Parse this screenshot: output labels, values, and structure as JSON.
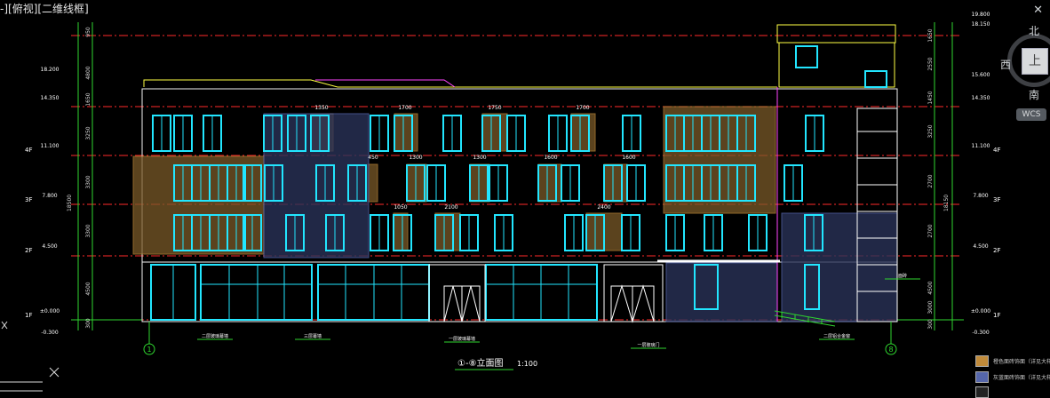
{
  "viewport": {
    "label": "-][俯视][二维线框]"
  },
  "viewcube": {
    "north": "北",
    "west": "西",
    "south": "南",
    "face": "上",
    "wcs": "WCS"
  },
  "drawing": {
    "title": "①-⑧立面图",
    "scale": "1:100",
    "axis_left": "1",
    "axis_right": "8",
    "levels_left": [
      {
        "name": "",
        "value": "18.200"
      },
      {
        "name": "",
        "value": "14.350"
      },
      {
        "name": "4F",
        "value": "11.100"
      },
      {
        "name": "3F",
        "value": "7.800"
      },
      {
        "name": "2F",
        "value": "4.500"
      },
      {
        "name": "1F",
        "value": "±0.000"
      },
      {
        "name": "",
        "value": "-0.300"
      }
    ],
    "levels_right": [
      {
        "name": "",
        "value": "19.800"
      },
      {
        "name": "",
        "value": "18.150"
      },
      {
        "name": "",
        "value": "15.600"
      },
      {
        "name": "",
        "value": "14.350"
      },
      {
        "name": "4F",
        "value": "11.100"
      },
      {
        "name": "3F",
        "value": "7.800"
      },
      {
        "name": "2F",
        "value": "4.500"
      },
      {
        "name": "1F",
        "value": "±0.000"
      },
      {
        "name": "",
        "value": "-0.300"
      }
    ],
    "dims_left": [
      "950",
      "4800",
      "1650",
      "3250",
      "3300",
      "3300",
      "4500",
      "300"
    ],
    "dims_right": [
      "1650",
      "2550",
      "1450",
      "3250",
      "2700",
      "2700",
      "4500",
      "3000",
      "300"
    ],
    "overall_left": "18500",
    "overall_right": "18150",
    "window_dims": [
      "1350",
      "1700",
      "1750",
      "1700",
      "450",
      "1300",
      "1300",
      "1600",
      "1600",
      "1050",
      "2100",
      "2400"
    ],
    "callouts": [
      "二层玻璃幕墙",
      "三层幕墙",
      "一层玻璃幕墙",
      "一层玻璃门",
      "二层铝合金窗",
      "面砖"
    ]
  },
  "legend": [
    {
      "text": "橙色面砖饰面（详见大样）",
      "color": "#c08a3a"
    },
    {
      "text": "灰蓝面砖饰面（详见大样）",
      "color": "#5566aa"
    }
  ]
}
